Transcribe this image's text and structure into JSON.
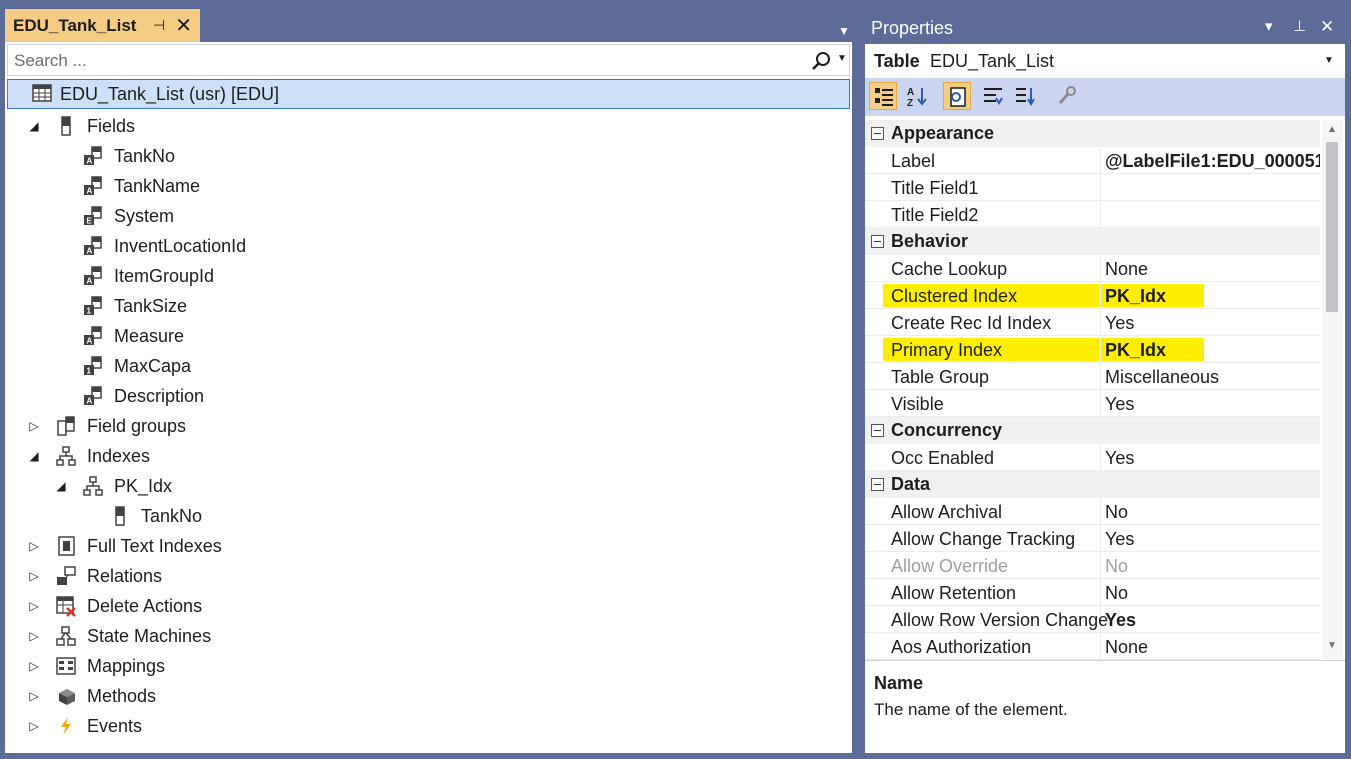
{
  "doc_tab": {
    "title": "EDU_Tank_List",
    "pin_glyph": "⊣",
    "close_glyph": "✕"
  },
  "search": {
    "placeholder": "Search ...",
    "value": ""
  },
  "tree": {
    "root": "EDU_Tank_List (usr) [EDU]",
    "nodes": [
      {
        "label": "Fields",
        "expander": "◢",
        "icon": "field-icon"
      },
      {
        "label": "TankNo",
        "expander": "",
        "icon": "string-field-icon"
      },
      {
        "label": "TankName",
        "expander": "",
        "icon": "string-field-icon"
      },
      {
        "label": "System",
        "expander": "",
        "icon": "enum-field-icon"
      },
      {
        "label": "InventLocationId",
        "expander": "",
        "icon": "string-field-icon"
      },
      {
        "label": "ItemGroupId",
        "expander": "",
        "icon": "string-field-icon"
      },
      {
        "label": "TankSize",
        "expander": "",
        "icon": "int-field-icon"
      },
      {
        "label": "Measure",
        "expander": "",
        "icon": "string-field-icon"
      },
      {
        "label": "MaxCapa",
        "expander": "",
        "icon": "int-field-icon"
      },
      {
        "label": "Description",
        "expander": "",
        "icon": "string-field-icon"
      },
      {
        "label": "Field groups",
        "expander": "▷",
        "icon": "field-group-icon"
      },
      {
        "label": "Indexes",
        "expander": "◢",
        "icon": "index-icon"
      },
      {
        "label": "PK_Idx",
        "expander": "◢",
        "icon": "index-icon"
      },
      {
        "label": "TankNo",
        "expander": "",
        "icon": "field-icon"
      },
      {
        "label": "Full Text Indexes",
        "expander": "▷",
        "icon": "full-text-index-icon"
      },
      {
        "label": "Relations",
        "expander": "▷",
        "icon": "relation-icon"
      },
      {
        "label": "Delete Actions",
        "expander": "▷",
        "icon": "delete-action-icon"
      },
      {
        "label": "State Machines",
        "expander": "▷",
        "icon": "state-machine-icon"
      },
      {
        "label": "Mappings",
        "expander": "▷",
        "icon": "mapping-icon"
      },
      {
        "label": "Methods",
        "expander": "▷",
        "icon": "method-icon"
      },
      {
        "label": "Events",
        "expander": "▷",
        "icon": "event-icon"
      }
    ]
  },
  "properties": {
    "title": "Properties",
    "object_kind": "Table",
    "object_name": "EDU_Tank_List",
    "categories": [
      {
        "name": "Appearance",
        "props": [
          {
            "name": "Label",
            "value": "@LabelFile1:EDU_000051",
            "bold": true
          },
          {
            "name": "Title Field1",
            "value": ""
          },
          {
            "name": "Title Field2",
            "value": ""
          }
        ]
      },
      {
        "name": "Behavior",
        "props": [
          {
            "name": "Cache Lookup",
            "value": "None"
          },
          {
            "name": "Clustered Index",
            "value": "PK_Idx",
            "bold": true,
            "highlight": true
          },
          {
            "name": "Create Rec Id Index",
            "value": "Yes"
          },
          {
            "name": "Primary Index",
            "value": "PK_Idx",
            "bold": true,
            "highlight": true
          },
          {
            "name": "Table Group",
            "value": "Miscellaneous"
          },
          {
            "name": "Visible",
            "value": "Yes"
          }
        ]
      },
      {
        "name": "Concurrency",
        "props": [
          {
            "name": "Occ Enabled",
            "value": "Yes"
          }
        ]
      },
      {
        "name": "Data",
        "props": [
          {
            "name": "Allow Archival",
            "value": "No"
          },
          {
            "name": "Allow Change Tracking",
            "value": "Yes"
          },
          {
            "name": "Allow Override",
            "value": "No",
            "disabled": true
          },
          {
            "name": "Allow Retention",
            "value": "No"
          },
          {
            "name": "Allow Row Version Change",
            "value": "Yes",
            "bold": true
          },
          {
            "name": "Aos Authorization",
            "value": "None"
          }
        ]
      }
    ],
    "description": {
      "name": "Name",
      "text": "The name of the element."
    }
  },
  "colors": {
    "highlight": "#ffee00",
    "tab_active": "#f5cc84",
    "chrome": "#5d6b99",
    "selection": "#cce0f7"
  }
}
